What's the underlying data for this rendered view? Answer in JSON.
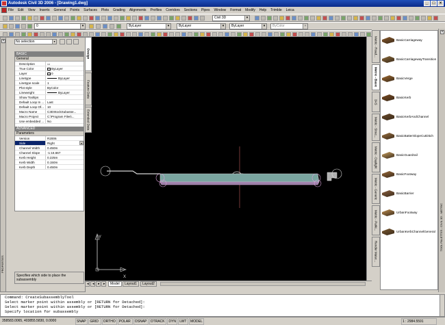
{
  "window": {
    "title": "Autodesk Civil 3D 2006 - [Drawing1.dwg]"
  },
  "menu": [
    "File",
    "Edit",
    "View",
    "Inserts",
    "General",
    "Points",
    "Surfaces",
    "Plots",
    "Grading",
    "Alignments",
    "Profiles",
    "Corridors",
    "Sections",
    "Pipes",
    "Window",
    "Format",
    "Modify",
    "Help",
    "Trimble",
    "Leica"
  ],
  "toolbar": {
    "workspace": "Civil 3D",
    "layer_state": "0",
    "color": "ByLayer",
    "linetype": "ByLayer",
    "lineweight": "ByLayer",
    "plotstyle": "ByColor"
  },
  "properties": {
    "selection": "No selection",
    "sections": {
      "basic": "BASIC",
      "advanced": "ADVANCED"
    },
    "general_label": "General",
    "parameters_label": "Parameters",
    "general_rows": [
      {
        "k": "Description",
        "v": ""
      },
      {
        "k": "True Color",
        "v": "ByLayer"
      },
      {
        "k": "Layer",
        "v": "0"
      },
      {
        "k": "Linetype",
        "v": "ByLayer"
      },
      {
        "k": "Linetype scale",
        "v": "1"
      },
      {
        "k": "Plot style",
        "v": "ByColor"
      },
      {
        "k": "Lineweight",
        "v": "ByLayer"
      },
      {
        "k": "Show Tooltips",
        "v": ""
      },
      {
        "k": "Default Loop In ...",
        "v": "Last"
      },
      {
        "k": "Default Loop Of...",
        "v": "10"
      },
      {
        "k": "Macro Name",
        "v": "C3DStockSubasse..."
      },
      {
        "k": "Macro Project",
        "v": "C:\\Program Files\\..."
      },
      {
        "k": "Use embedded ...",
        "v": "No"
      }
    ],
    "param_rows": [
      {
        "k": "Version",
        "v": "R2006"
      },
      {
        "k": "Side",
        "v": "Right"
      },
      {
        "k": "Channel Width",
        "v": "0.450m"
      },
      {
        "k": "Channel Slope",
        "v": "-1:16.667"
      },
      {
        "k": "Kerb Height",
        "v": "0.225m"
      },
      {
        "k": "Kerb Width",
        "v": "0.150m"
      },
      {
        "k": "Kerb Depth",
        "v": "0.450m"
      }
    ],
    "description": "Specifies which side to place the subassembly",
    "side_label": "PROPERTIES",
    "tabs": [
      "Design",
      "Feature Data",
      "Extended Data"
    ]
  },
  "layout_tabs": [
    "Model",
    "Layout1",
    "Layout2"
  ],
  "palette": {
    "side_label": "TOOL PALETTES - CIVIL 3D - METRIC",
    "tabs": [
      "Metric - Road...",
      "Metric - Basic",
      "3AS",
      "Metric - Struc...",
      "Metric - Daylight",
      "Metric - Generic",
      "Metric - Parki...",
      "Render Mater..."
    ],
    "tools": [
      "BasicCarriageway",
      "BasicCarriagewayTransition",
      "BasicVerge",
      "BasicKerb",
      "BasicKerbAndChannel",
      "BasicBatterSlopeCutDitch",
      "BasicGuardrail",
      "BasicFootway",
      "BasicBarrier",
      "UrbanFootway",
      "UrbanKerbChannelGeneral"
    ]
  },
  "command": {
    "lines": [
      "Command: CreateSubassemblyTool",
      "Select marker point within assembly or [RETURN for Detached]:",
      "Select marker point within assembly or [RETURN for Detached]:",
      "Specify location for subassembly"
    ]
  },
  "status": {
    "coords": "358583.0065, 403855.5830, 0.0000",
    "toggles": [
      "SNAP",
      "GRID",
      "ORTHO",
      "POLAR",
      "OSNAP",
      "OTRACK",
      "DYN",
      "LWT",
      "MODEL"
    ],
    "scale": "1 : 2984.5591"
  },
  "colors": {
    "title_bar": "#0a2a8a",
    "canvas": "#000000",
    "selected_row": "#0a246a"
  }
}
